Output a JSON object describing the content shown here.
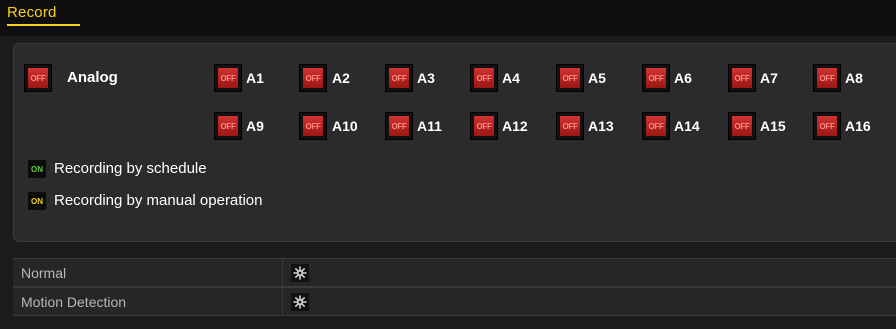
{
  "header": {
    "tab_label": "Record"
  },
  "panel": {
    "analog_label": "Analog",
    "analog_toggle": "OFF",
    "channels_row1": [
      {
        "label": "A1",
        "state": "OFF"
      },
      {
        "label": "A2",
        "state": "OFF"
      },
      {
        "label": "A3",
        "state": "OFF"
      },
      {
        "label": "A4",
        "state": "OFF"
      },
      {
        "label": "A5",
        "state": "OFF"
      },
      {
        "label": "A6",
        "state": "OFF"
      },
      {
        "label": "A7",
        "state": "OFF"
      },
      {
        "label": "A8",
        "state": "OFF"
      }
    ],
    "channels_row2": [
      {
        "label": "A9",
        "state": "OFF"
      },
      {
        "label": "A10",
        "state": "OFF"
      },
      {
        "label": "A11",
        "state": "OFF"
      },
      {
        "label": "A12",
        "state": "OFF"
      },
      {
        "label": "A13",
        "state": "OFF"
      },
      {
        "label": "A14",
        "state": "OFF"
      },
      {
        "label": "A15",
        "state": "OFF"
      },
      {
        "label": "A16",
        "state": "OFF"
      }
    ],
    "legend": [
      {
        "chip": "ON",
        "chip_color": "#5dcc3a",
        "text": "Recording by schedule"
      },
      {
        "chip": "ON",
        "chip_color": "#f3d516",
        "text": "Recording by manual operation"
      }
    ]
  },
  "table": {
    "rows": [
      {
        "label": "Normal",
        "icon": "gear-icon"
      },
      {
        "label": "Motion Detection",
        "icon": "gear-icon"
      }
    ]
  },
  "colors": {
    "accent": "#f7d21d",
    "off_red": "#c62828",
    "schedule_green": "#5dcc3a",
    "manual_yellow": "#f3d516"
  }
}
